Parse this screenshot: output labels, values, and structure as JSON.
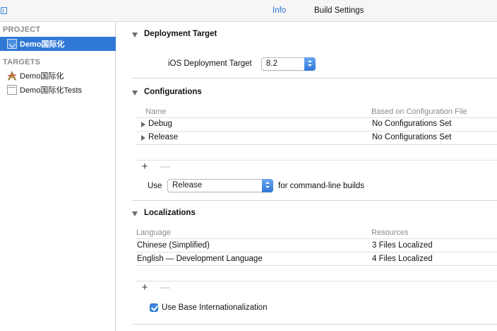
{
  "topbar": {
    "tabs": [
      {
        "label": "Info",
        "selected": true
      },
      {
        "label": "Build Settings",
        "selected": false
      }
    ]
  },
  "sidebar": {
    "project_header": "PROJECT",
    "project_item": {
      "label": "Demo国际化",
      "icon": "project-doc-icon"
    },
    "targets_header": "TARGETS",
    "targets": [
      {
        "label": "Demo国际化",
        "icon": "app-target-icon"
      },
      {
        "label": "Demo国际化Tests",
        "icon": "test-bundle-icon"
      }
    ]
  },
  "deployment": {
    "title": "Deployment Target",
    "field_label": "iOS Deployment Target",
    "value": "8.2"
  },
  "configurations": {
    "title": "Configurations",
    "columns": [
      "Name",
      "Based on Configuration File"
    ],
    "rows": [
      {
        "name": "Debug",
        "file": "No Configurations Set"
      },
      {
        "name": "Release",
        "file": "No Configurations Set"
      }
    ],
    "add_label": "+",
    "remove_label": "—",
    "use_label": "Use",
    "use_value": "Release",
    "use_suffix": "for command-line builds"
  },
  "localizations": {
    "title": "Localizations",
    "columns": [
      "Language",
      "Resources"
    ],
    "rows": [
      {
        "language": "Chinese (Simplified)",
        "resources": "3 Files Localized"
      },
      {
        "language": "English — Development Language",
        "resources": "4 Files Localized"
      }
    ],
    "add_label": "+",
    "remove_label": "—",
    "checkbox_label": "Use Base Internationalization",
    "checkbox_checked": true
  },
  "colors": {
    "accent": "#2f78d6",
    "selected_tab": "#2b73d0"
  }
}
